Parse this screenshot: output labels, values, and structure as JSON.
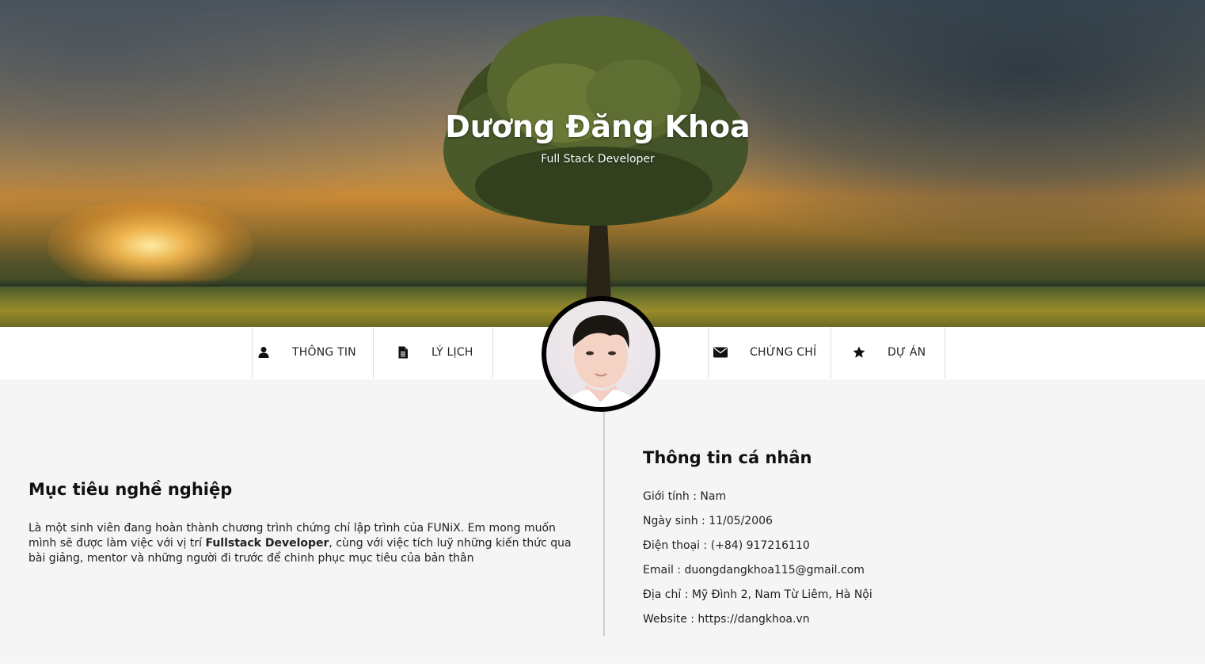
{
  "hero": {
    "name": "Dương Đăng Khoa",
    "subtitle": "Full Stack Developer"
  },
  "nav": {
    "items": [
      {
        "label": "THÔNG TIN",
        "icon": "user-icon"
      },
      {
        "label": "LÝ LỊCH",
        "icon": "file-text-icon"
      },
      {
        "label": "CHỨNG CHỈ",
        "icon": "envelope-icon"
      },
      {
        "label": "DỰ ÁN",
        "icon": "star-icon"
      }
    ]
  },
  "career": {
    "title": "Mục tiêu nghề nghiệp",
    "text_before": "Là một sinh viên đang hoàn thành chương trình chứng chỉ lập trình của FUNiX. Em mong muốn mình sẽ được làm việc với vị trí ",
    "text_bold": "Fullstack Developer",
    "text_after": ", cùng với việc tích luỹ những kiến thức qua bài giảng, mentor và những người đi trước để chinh phục mục tiêu của bản thân"
  },
  "personal": {
    "title": "Thông tin cá nhân",
    "items": [
      "Giới tính : Nam",
      "Ngày sinh : 11/05/2006",
      "Điện thoại : (+84) 917216110",
      "Email : duongdangkhoa115@gmail.com",
      "Địa chỉ : Mỹ Đình 2, Nam Từ Liêm, Hà Nội",
      "Website : https://dangkhoa.vn"
    ]
  },
  "colors": {
    "background": "#f5f5f5",
    "nav_background": "#ffffff",
    "text": "#1a1a1a",
    "avatar_border": "#000000"
  }
}
